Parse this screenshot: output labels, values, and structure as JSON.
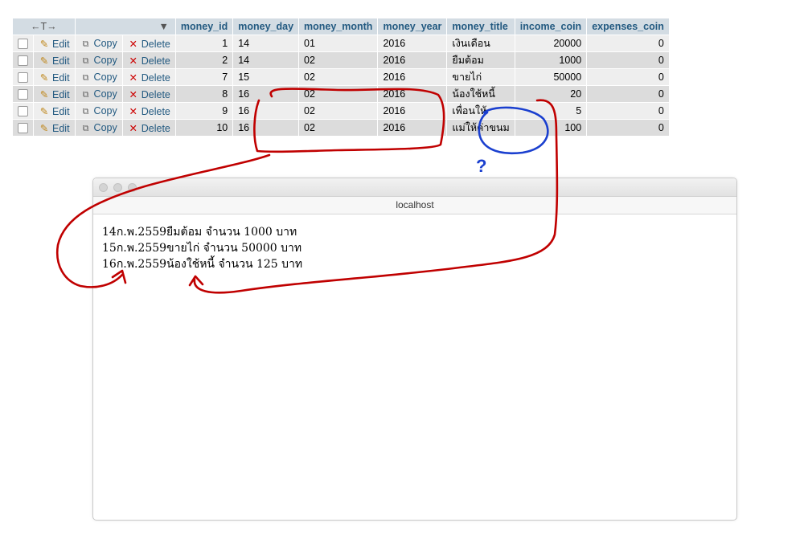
{
  "table": {
    "arrows_header": "←T→",
    "sort_icon": "▼",
    "columns": [
      "money_id",
      "money_day",
      "money_month",
      "money_year",
      "money_title",
      "income_coin",
      "expenses_coin"
    ],
    "actions": {
      "edit": "Edit",
      "copy": "Copy",
      "delete": "Delete"
    },
    "rows": [
      {
        "money_id": "1",
        "money_day": "14",
        "money_month": "01",
        "money_year": "2016",
        "money_title": "เงินเดือน",
        "income_coin": "20000",
        "expenses_coin": "0"
      },
      {
        "money_id": "2",
        "money_day": "14",
        "money_month": "02",
        "money_year": "2016",
        "money_title": "ยืมต้อม",
        "income_coin": "1000",
        "expenses_coin": "0"
      },
      {
        "money_id": "7",
        "money_day": "15",
        "money_month": "02",
        "money_year": "2016",
        "money_title": "ขายไก่",
        "income_coin": "50000",
        "expenses_coin": "0"
      },
      {
        "money_id": "8",
        "money_day": "16",
        "money_month": "02",
        "money_year": "2016",
        "money_title": "น้องใช้หนี้",
        "income_coin": "20",
        "expenses_coin": "0"
      },
      {
        "money_id": "9",
        "money_day": "16",
        "money_month": "02",
        "money_year": "2016",
        "money_title": "เพื่อนให้",
        "income_coin": "5",
        "expenses_coin": "0"
      },
      {
        "money_id": "10",
        "money_day": "16",
        "money_month": "02",
        "money_year": "2016",
        "money_title": "แม่ให้ค่าขนม",
        "income_coin": "100",
        "expenses_coin": "0"
      }
    ]
  },
  "browser": {
    "address": "localhost",
    "lines": [
      "14ก.พ.2559ยืมต้อม จำนวน 1000 บาท",
      "15ก.พ.2559ขายไก่ จำนวน 50000 บาท",
      "16ก.พ.2559น้องใช้หนี้ จำนวน 125 บาท"
    ]
  },
  "annotation": {
    "question_mark": "?",
    "red_color": "#c00000",
    "blue_color": "#1a3fcf"
  }
}
